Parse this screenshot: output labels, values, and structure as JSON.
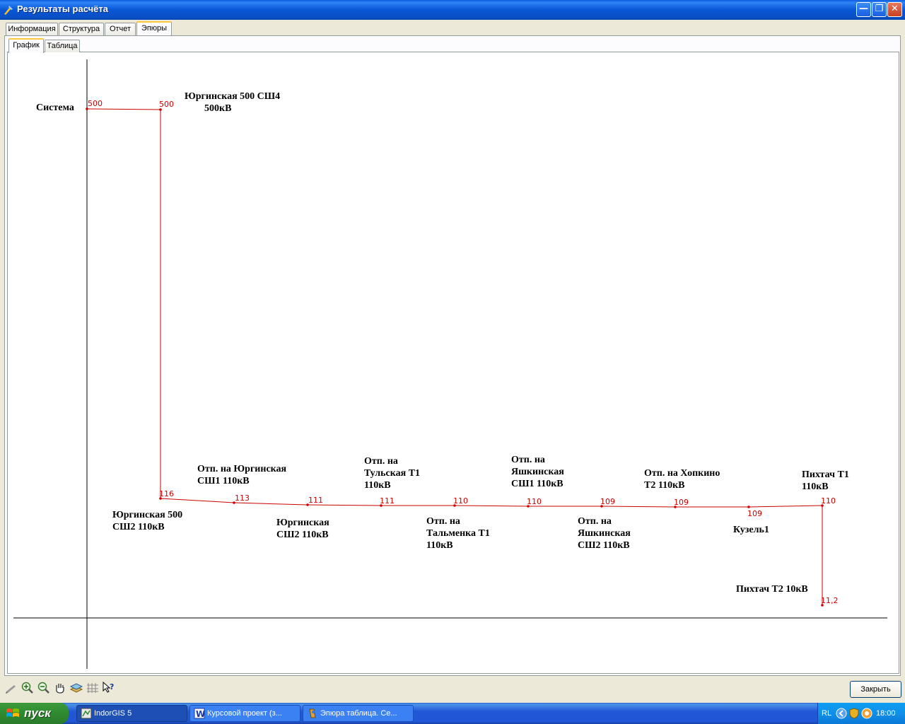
{
  "window": {
    "title": "Результаты расчёта"
  },
  "tabs_outer": [
    "Информация",
    "Структура",
    "Отчет",
    "Эпюры"
  ],
  "tabs_inner": [
    "График",
    "Таблица"
  ],
  "chart_data": {
    "type": "line",
    "title": "",
    "points": [
      {
        "name": "Система",
        "value": "500"
      },
      {
        "name": "Юргинская 500 СШ4 500кВ",
        "value": "500"
      },
      {
        "name": "Юргинская 500 СШ2 110кВ",
        "value": "116"
      },
      {
        "name": "Отп. на Юргинская СШ1 110кВ",
        "value": "113"
      },
      {
        "name": "Юргинская СШ2 110кВ",
        "value": "111"
      },
      {
        "name": "Отп. на Тульская Т1 110кВ",
        "value": "111"
      },
      {
        "name": "Отп. на Тальменка Т1 110кВ",
        "value": "110"
      },
      {
        "name": "Отп. на Яшкинская СШ1 110кВ",
        "value": "110"
      },
      {
        "name": "Отп. на Яшкинская СШ2 110кВ",
        "value": "109"
      },
      {
        "name": "Отп. на Хопкино Т2 110кВ",
        "value": "109"
      },
      {
        "name": "Кузель1",
        "value": "109"
      },
      {
        "name": "Пихтач Т1 110кВ",
        "value": "110"
      },
      {
        "name": "Пихтач Т2 10кВ",
        "value": "11,2"
      }
    ],
    "label_lines": [
      [
        "Система"
      ],
      [
        "Юргинская 500 СШ4",
        "500кВ"
      ],
      [
        "Юргинская 500",
        "СШ2 110кВ"
      ],
      [
        "Отп. на Юргинская",
        "СШ1 110кВ"
      ],
      [
        "Юргинская",
        "СШ2 110кВ"
      ],
      [
        "Отп. на",
        "Тульская Т1",
        "110кВ"
      ],
      [
        "Отп. на",
        "Тальменка Т1",
        "110кВ"
      ],
      [
        "Отп. на",
        "Яшкинская",
        "СШ1 110кВ"
      ],
      [
        "Отп. на",
        "Яшкинская",
        "СШ2 110кВ"
      ],
      [
        "Отп. на Хопкино",
        "Т2 110кВ"
      ],
      [
        "Кузель1"
      ],
      [
        "Пихтач Т1",
        "110кВ"
      ],
      [
        "Пихтач Т2 10кВ"
      ]
    ],
    "line_color": "#cc0000"
  },
  "toolbar": {
    "icons": [
      "pen-icon",
      "zoom-in-icon",
      "zoom-out-icon",
      "pan-hand-icon",
      "layers-icon",
      "grid-icon",
      "help-pointer-icon"
    ]
  },
  "buttons": {
    "close_label": "Закрыть"
  },
  "taskbar": {
    "start_label": "пуск",
    "tasks": [
      "IndorGIS 5",
      "Курсовой проект (з...",
      "Эпюра таблица. Се..."
    ],
    "lang": "RL",
    "clock": "18:00"
  }
}
